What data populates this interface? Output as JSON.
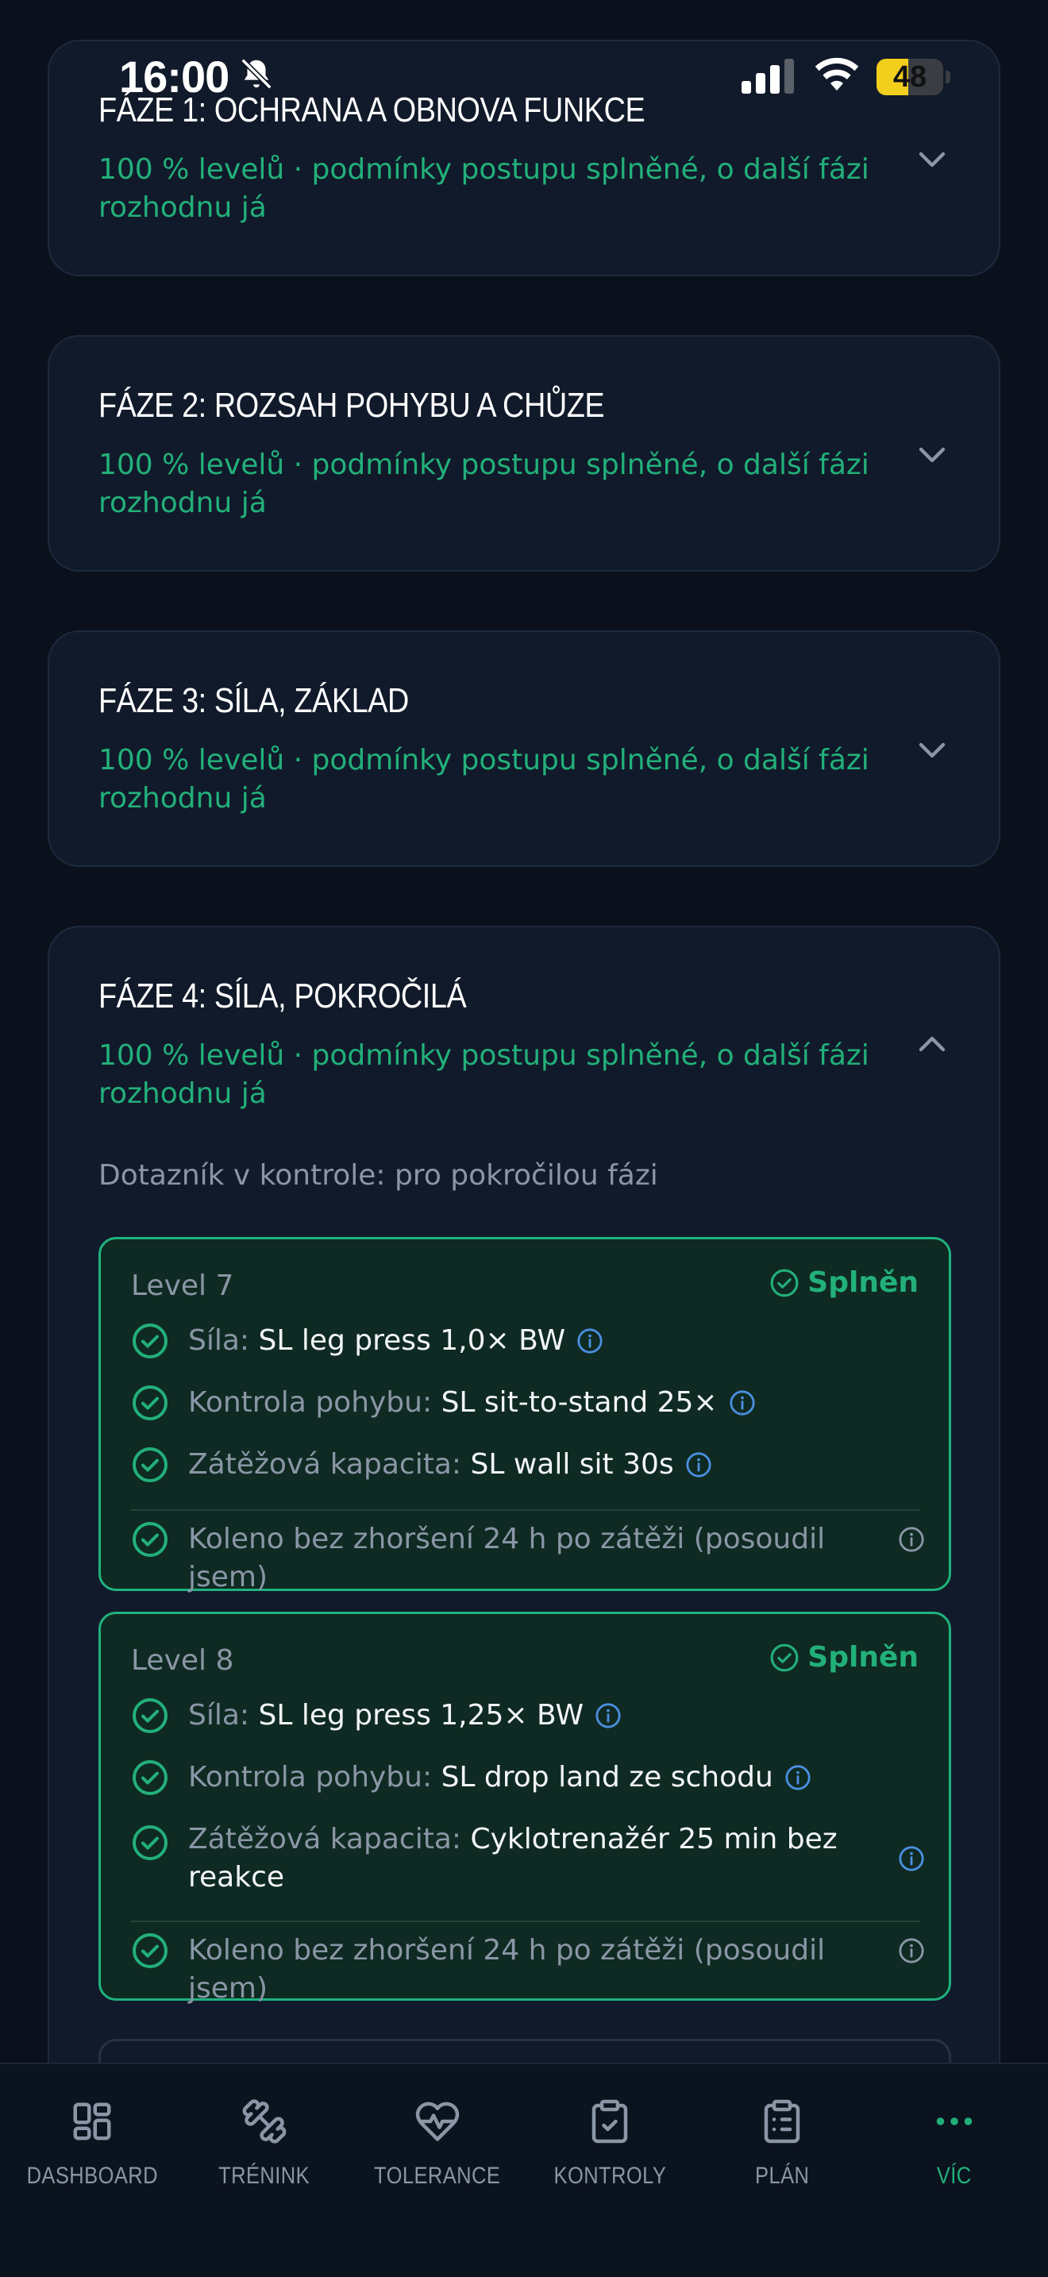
{
  "status_bar": {
    "time": "16:00",
    "battery": "48",
    "battery_fraction": 0.48
  },
  "colors": {
    "accent": "#22b07a",
    "background": "#0a111c",
    "card": "#111a2a",
    "level_card": "#0f2a22",
    "info": "#4a8fe0",
    "battery": "#f2cf1d"
  },
  "phases": [
    {
      "title": "FÁZE 1: OCHRANA A OBNOVA FUNKCE",
      "subtitle": "100 % levelů · podmínky postupu splněné, o další fázi rozhodnu já",
      "expanded": false
    },
    {
      "title": "FÁZE 2: ROZSAH POHYBU A CHŮZE",
      "subtitle": "100 % levelů · podmínky postupu splněné, o další fázi rozhodnu já",
      "expanded": false
    },
    {
      "title": "FÁZE 3: SÍLA, ZÁKLAD",
      "subtitle": "100 % levelů · podmínky postupu splněné, o další fázi rozhodnu já",
      "expanded": false
    },
    {
      "title": "FÁZE 4: SÍLA, POKROČILÁ",
      "subtitle": "100 % levelů · podmínky postupu splněné, o další fázi rozhodnu já",
      "expanded": true,
      "questionnaire": "Dotazník v kontrole: pro pokročilou fázi",
      "levels": [
        {
          "title": "Level 7",
          "status": "Splněn",
          "requirements": [
            {
              "label": "Síla:",
              "value": "SL leg press 1,0× BW"
            },
            {
              "label": "Kontrola pohybu:",
              "value": "SL sit-to-stand 25×"
            },
            {
              "label": "Zátěžová kapacita:",
              "value": "SL wall sit 30s"
            }
          ],
          "knee_check": "Koleno bez zhoršení 24 h po zátěži (posoudil jsem)"
        },
        {
          "title": "Level 8",
          "status": "Splněn",
          "requirements": [
            {
              "label": "Síla:",
              "value": "SL leg press 1,25× BW"
            },
            {
              "label": "Kontrola pohybu:",
              "value": "SL drop land ze schodu"
            },
            {
              "label": "Zátěžová kapacita:",
              "value": "Cyklotrenažér 25 min bez reakce"
            }
          ],
          "knee_check": "Koleno bez zhoršení 24 h po zátěži (posoudil jsem)"
        }
      ]
    }
  ],
  "nav": [
    {
      "label": "DASHBOARD",
      "icon": "dashboard-grid-icon",
      "active": false
    },
    {
      "label": "TRÉNINK",
      "icon": "dumbbell-icon",
      "active": false
    },
    {
      "label": "TOLERANCE",
      "icon": "heart-pulse-icon",
      "active": false
    },
    {
      "label": "KONTROLY",
      "icon": "clipboard-check-icon",
      "active": false
    },
    {
      "label": "PLÁN",
      "icon": "clipboard-list-icon",
      "active": false
    },
    {
      "label": "VÍC",
      "icon": "more-dots-icon",
      "active": true
    }
  ]
}
